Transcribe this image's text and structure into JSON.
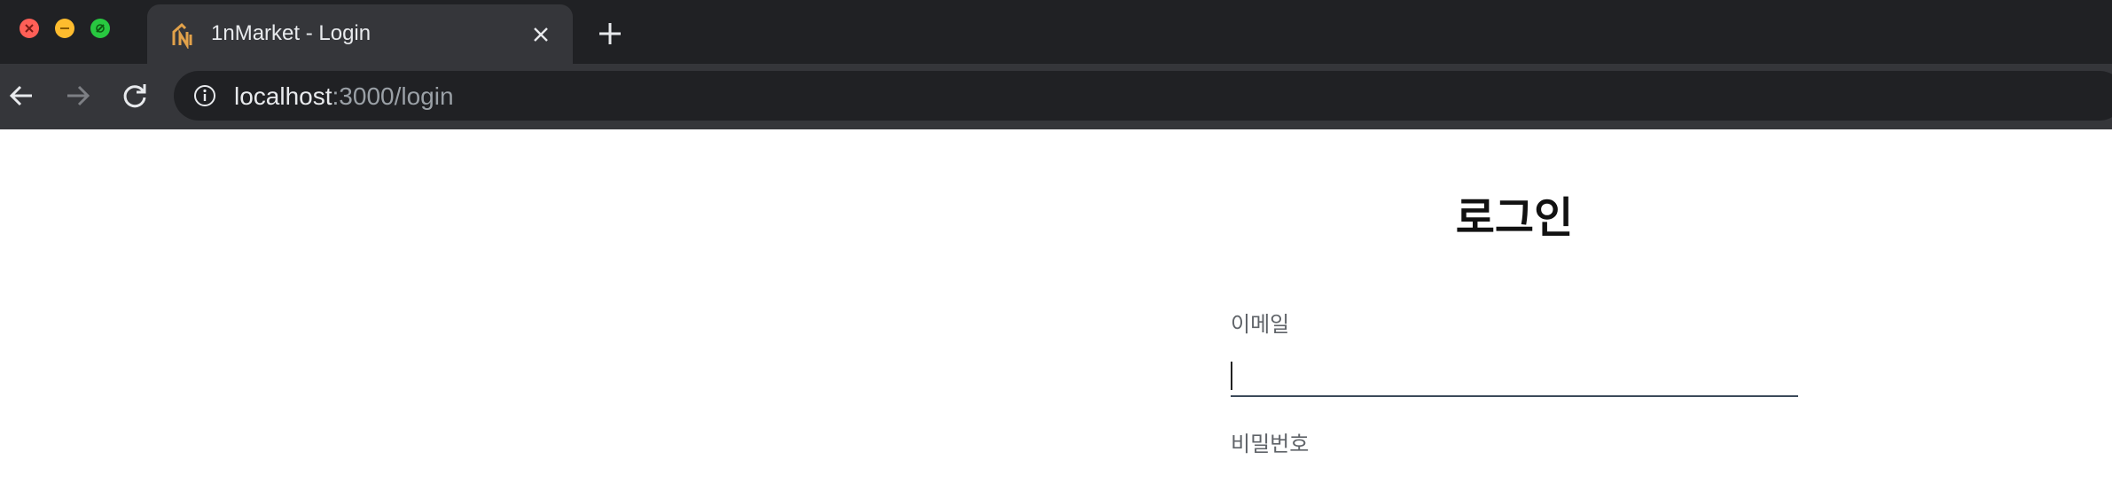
{
  "browser": {
    "tab": {
      "title": "1nMarket - Login",
      "favicon": "1nmarket-logo-icon"
    },
    "address": {
      "host": "localhost",
      "path": ":3000/login"
    },
    "icons": {
      "back": "arrow-left-icon",
      "forward": "arrow-right-icon",
      "reload": "reload-icon",
      "info": "info-icon",
      "new_tab": "plus-icon",
      "tab_close": "close-icon"
    }
  },
  "login": {
    "title": "로그인",
    "email_label": "이메일",
    "email_value": "",
    "password_label": "비밀번호"
  },
  "colors": {
    "chrome_dark": "#202124",
    "chrome_mid": "#35363a",
    "input_underline": "#3c4a5a"
  }
}
